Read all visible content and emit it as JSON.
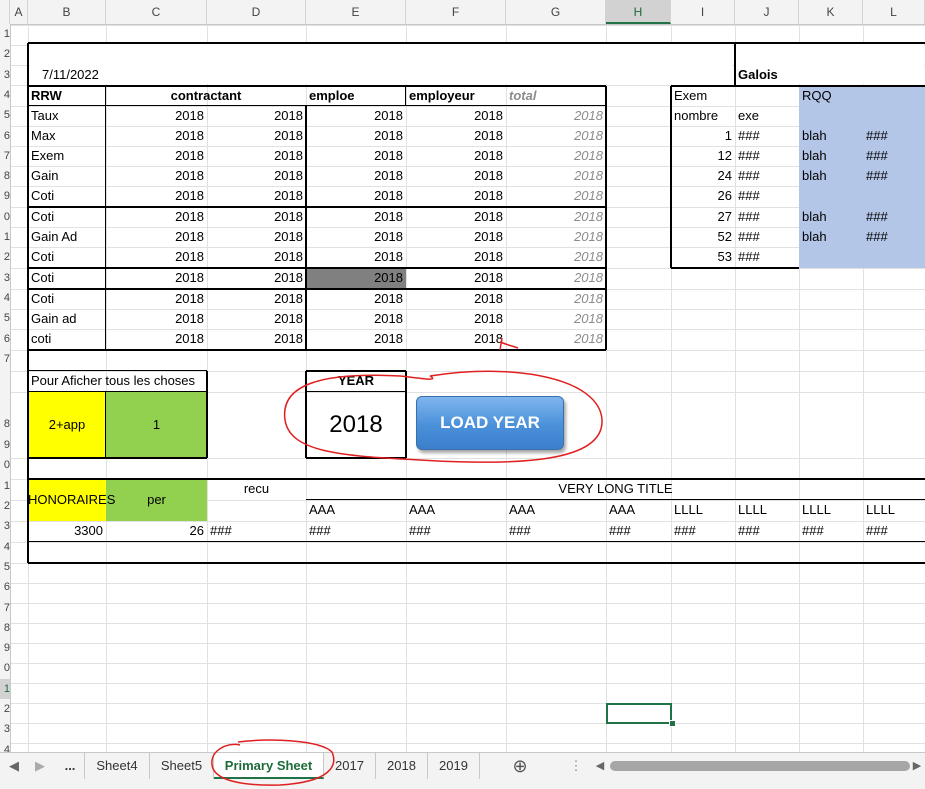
{
  "column_headers": [
    "A",
    "B",
    "C",
    "D",
    "E",
    "F",
    "G",
    "H",
    "I",
    "J",
    "K",
    "L"
  ],
  "selected_column": "H",
  "row_headers": [
    "1",
    "2",
    "3",
    "4",
    "5",
    "6",
    "7",
    "8",
    "9",
    "0",
    "1",
    "2",
    "3",
    "4",
    "5",
    "6",
    "7",
    "8",
    "9",
    "0",
    "1",
    "2",
    "3",
    "4",
    "5",
    "6",
    "7",
    "8",
    "9",
    "0",
    "1",
    "2",
    "3",
    "4"
  ],
  "selected_row_index": 30,
  "header": {
    "date": "7/11/2022",
    "galois": "Galois"
  },
  "main_table": {
    "headers": {
      "rrw": "RRW",
      "contractant": "contractant",
      "emploe": "emploe",
      "employeur": "employeur",
      "total": "total"
    },
    "rows": [
      {
        "label": "Taux",
        "c": "2018",
        "d": "2018",
        "e": "2018",
        "f": "2018",
        "g": "2018"
      },
      {
        "label": "Max",
        "c": "2018",
        "d": "2018",
        "e": "2018",
        "f": "2018",
        "g": "2018"
      },
      {
        "label": "Exem",
        "c": "2018",
        "d": "2018",
        "e": "2018",
        "f": "2018",
        "g": "2018"
      },
      {
        "label": "Gain",
        "c": "2018",
        "d": "2018",
        "e": "2018",
        "f": "2018",
        "g": "2018"
      },
      {
        "label": "Coti",
        "c": "2018",
        "d": "2018",
        "e": "2018",
        "f": "2018",
        "g": "2018"
      },
      {
        "label": "Coti",
        "c": "2018",
        "d": "2018",
        "e": "2018",
        "f": "2018",
        "g": "2018"
      },
      {
        "label": "Gain Ad",
        "c": "2018",
        "d": "2018",
        "e": "2018",
        "f": "2018",
        "g": "2018"
      },
      {
        "label": "Coti",
        "c": "2018",
        "d": "2018",
        "e": "2018",
        "f": "2018",
        "g": "2018"
      },
      {
        "label": "Coti",
        "c": "2018",
        "d": "2018",
        "e": "2018",
        "f": "2018",
        "g": "2018"
      },
      {
        "label": "Coti",
        "c": "2018",
        "d": "2018",
        "e": "2018",
        "f": "2018",
        "g": "2018"
      },
      {
        "label": "Gain ad",
        "c": "2018",
        "d": "2018",
        "e": "2018",
        "f": "2018",
        "g": "2018"
      },
      {
        "label": "coti",
        "c": "2018",
        "d": "2018",
        "e": "2018",
        "f": "2018",
        "g": "2018"
      }
    ]
  },
  "side_table": {
    "exem": "Exem",
    "rqq": "RQQ",
    "nombre": "nombre",
    "exe": "exe",
    "rows": [
      {
        "n": "1",
        "j": "###",
        "k": "blah",
        "l": "###"
      },
      {
        "n": "12",
        "j": "###",
        "k": "blah",
        "l": "###"
      },
      {
        "n": "24",
        "j": "###",
        "k": "blah",
        "l": "###"
      },
      {
        "n": "26",
        "j": "###",
        "k": "",
        "l": ""
      },
      {
        "n": "27",
        "j": "###",
        "k": "blah",
        "l": "###"
      },
      {
        "n": "52",
        "j": "###",
        "k": "blah",
        "l": "###"
      },
      {
        "n": "53",
        "j": "###",
        "k": "",
        "l": ""
      }
    ]
  },
  "control": {
    "afficher_label": "Pour Aficher tous les choses",
    "app_value": "2+app",
    "one_value": "1",
    "year_label": "YEAR",
    "year_value": "2018",
    "load_button": "LOAD YEAR"
  },
  "bottom_table": {
    "honoraires": "HONORAIRES",
    "per": "per",
    "recu": "recu",
    "long_title": "VERY LONG TITLE",
    "subheaders": [
      "AAA",
      "AAA",
      "AAA",
      "AAA",
      "LLLL",
      "LLLL",
      "LLLL",
      "LLLL"
    ],
    "values": {
      "b": "3300",
      "c": "26",
      "d": "###",
      "rest": [
        "###",
        "###",
        "###",
        "###",
        "###",
        "###",
        "###",
        "###"
      ]
    }
  },
  "tabs": {
    "ellipsis": "...",
    "items": [
      "Sheet4",
      "Sheet5",
      "Primary Sheet",
      "2017",
      "2018",
      "2019"
    ],
    "active": "Primary Sheet"
  },
  "colors": {
    "yellow": "#ffff00",
    "green": "#92d050",
    "blue_fill": "#b4c6e7",
    "dark_gray": "#808080",
    "excel_green": "#217346",
    "annotation_red": "#e02020",
    "button_blue": "#4a90d9"
  }
}
